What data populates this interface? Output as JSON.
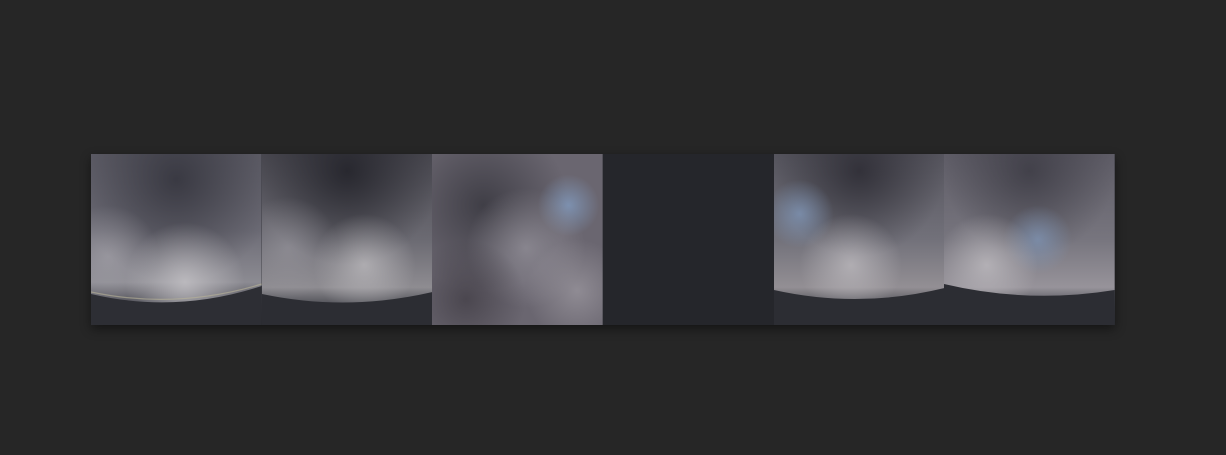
{
  "viewer": {
    "background_color": "#262626",
    "strip_background_color": "#25262b"
  },
  "cubemap_faces": [
    {
      "id": "face-1",
      "kind": "horizon-sky",
      "present": true
    },
    {
      "id": "face-2",
      "kind": "horizon-sky",
      "present": true
    },
    {
      "id": "face-3",
      "kind": "overhead-sky",
      "present": true
    },
    {
      "id": "face-4",
      "kind": "empty",
      "present": false
    },
    {
      "id": "face-5",
      "kind": "horizon-sky",
      "present": true
    },
    {
      "id": "face-6",
      "kind": "horizon-sky",
      "present": true
    }
  ],
  "palette": {
    "cloud_dark": "#3a3a44",
    "cloud_mid": "#6e6d78",
    "cloud_light": "#b9b7bd",
    "sky_blue": "#7f95b6",
    "ground": "#2a2b31"
  }
}
